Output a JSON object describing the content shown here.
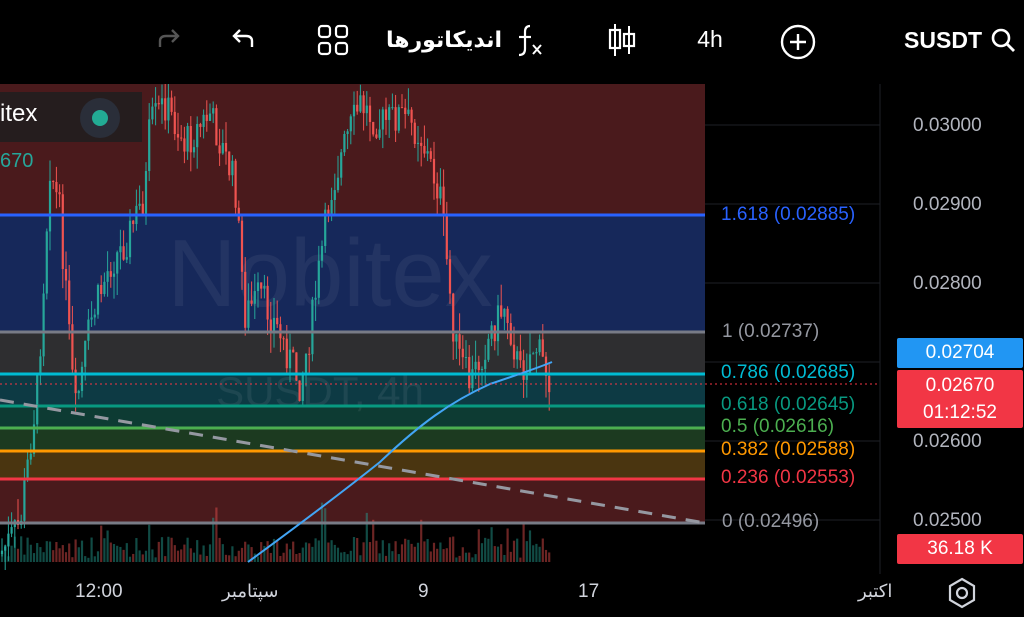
{
  "toolbar": {
    "symbol": "SUSDT",
    "interval": "4h",
    "indicators_label": "اندیکاتورها"
  },
  "legend": {
    "exchange_fragment": "itex",
    "value_fragment": "670"
  },
  "watermark": {
    "brand": "Nobitex",
    "pair": "SUSDT, 4h"
  },
  "price_axis": {
    "ticks": [
      "0.03000",
      "0.02900",
      "0.02800",
      "0.02600",
      "0.02500"
    ],
    "last_price": "0.02704",
    "current_price": "0.02670",
    "countdown": "01:12:52",
    "volume": "36.18 K"
  },
  "time_axis": {
    "labels": [
      "12:00",
      "سپتامبر",
      "9",
      "17",
      "اکتبر"
    ]
  },
  "fib_levels": [
    {
      "label": "1.618 (0.02885)",
      "color": "#2962ff"
    },
    {
      "label": "1 (0.02737)",
      "color": "#787b86"
    },
    {
      "label": "0.786 (0.02685)",
      "color": "#00bcd4"
    },
    {
      "label": "0.618 (0.02645)",
      "color": "#089981"
    },
    {
      "label": "0.5 (0.02616)",
      "color": "#4caf50"
    },
    {
      "label": "0.382 (0.02588)",
      "color": "#ff9800"
    },
    {
      "label": "0.236 (0.02553)",
      "color": "#f23645"
    },
    {
      "label": "0 (0.02496)",
      "color": "#787b86"
    }
  ],
  "colors": {
    "up": "#26a69a",
    "down": "#ef5350",
    "accent": "#2196f3",
    "price_badge": "#f23645"
  }
}
